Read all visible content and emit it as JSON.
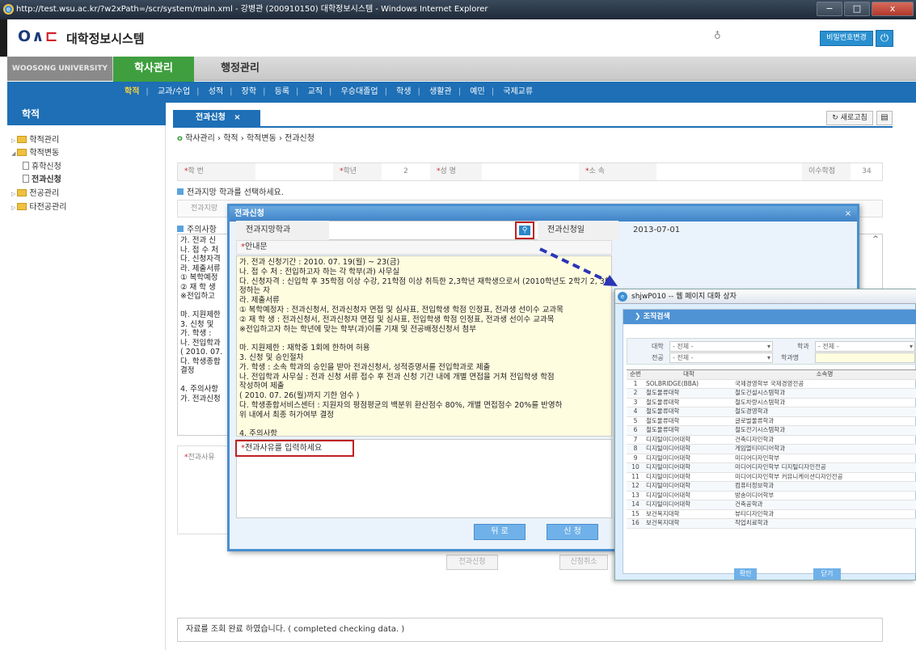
{
  "window": {
    "url": "http://test.wsu.ac.kr/?w2xPath=/scr/system/main.xml",
    "title_rest": " - 강병관 (200910150) 대학정보시스템 - Windows Internet Explorer",
    "btn_min": "−",
    "btn_max": "□",
    "btn_close": "x"
  },
  "header": {
    "logo_text": "대학정보시스템",
    "password_button": "비밀번호변경",
    "power_icon": "power-icon"
  },
  "mainmenu": {
    "university": "WOOSONG UNIVERSITY",
    "items": [
      "학사관리",
      "행정관리"
    ]
  },
  "submenu": {
    "items": [
      "학적",
      "교과/수업",
      "성적",
      "장학",
      "등록",
      "교직",
      "우승대졸업",
      "학생",
      "생활관",
      "예민",
      "국제교류"
    ]
  },
  "sidebar": {
    "title": "학적",
    "items": [
      "학적관리",
      "학적변동",
      "휴학신청",
      "전과신청",
      "전공관리",
      "타전공관리"
    ]
  },
  "content": {
    "tab_label": "전과신청",
    "tab_close": "×",
    "refresh": "새로고침",
    "breadcrumb": "학사관리 › 학적 › 학적변동 › 전과신청",
    "fields": {
      "hakbeon_label": "학 번",
      "haknyeon_label": "학년",
      "haknyeon_value": "2",
      "name_label": "성 명",
      "sosok_label": "소 속",
      "credits_label": "이수학점",
      "credits_value": "34"
    },
    "section_select": "전과지망 학과를 선택하세요.",
    "dept_label": "전과지망",
    "section_notes": "주의사항",
    "bg_notes": [
      "가. 전과 신",
      "나. 접 수 처",
      "다. 신청자격",
      "라. 제출서류",
      "① 복학예정",
      "② 재 학 생",
      "※전입하고",
      "",
      "마. 지원제한",
      "3. 신청 및",
      "가. 학생 :",
      "나. 전입학과",
      "( 2010. 07.",
      "다. 학생종합",
      "결정",
      "",
      "4. 주의사항",
      "가. 전과신청"
    ],
    "reason_label": "전과사유",
    "btn_apply": "전과신청",
    "btn_cancel": "신청취소",
    "status_message": "자료를 조회 완료 하였습니다. ( completed checking data. )"
  },
  "modal": {
    "title": "전과신청",
    "close": "×",
    "dept_label": "전과지망학과",
    "date_label": "전과신청일",
    "date_value": "2013-07-01",
    "guide_label": "안내문",
    "notice_lines": [
      "가. 전과 신청기간 : 2010. 07. 19(월) ~ 23(금)",
      "나. 접 수 처 : 전입하고자 하는 각 학부(과) 사무실",
      "다. 신청자격 : 신입학 후 35학점 이상 수강, 21학점 이상 취득한 2,3학년 재학생으로서 (2010학년도 2학기 2, 3학년 복학예정자 포함) 소속 학부(과)에서 인",
      "정하는 자",
      "라. 제출서류",
      "① 복학예정자 : 전과신청서, 전과신청자 면접 및 심사표, 전입학생 학점 인정표, 전과생 선이수 교과목",
      "② 재 학 생 : 전과신청서, 전과신청자 면접 및 심사표, 전입학생 학점 인정표, 전과생 선이수 교과목",
      "※전입하고자 하는 학년에 맞는 학부(과)이를 기재 및 전공배정신청서 첨부",
      "",
      "마. 지원제한 : 재학중 1회에 한하여 허용",
      "3. 신청 및 승인절차",
      "가. 학생 : 소속 학과의 승인을 받아 전과신청서, 성적증명서를 전입학과로 제출",
      "나. 전입학과 사무실 : 전과 신청 서류 접수 후 전과 신청 기간 내에 개별 면접을 거쳐 전입학생 학점",
      "작성하여 제출",
      "( 2010. 07. 26(월)까지 기한 엄수 )",
      "다. 학생종합서비스센터 : 지원자의 평점평균의 백분위 환산점수 80%, 개별 면접점수 20%를 반영하",
      "위 내에서 최종 허가여부 결정",
      "",
      "4. 주의사항"
    ],
    "reason_placeholder": "전과사유를 입력하세요",
    "btn_back": "뒤 로",
    "btn_apply": "신 청"
  },
  "popup": {
    "title": "shjwP010 -- 웹 페이지 대화 상자",
    "head": "조직검색",
    "filter": {
      "college_label": "대학",
      "college_value": "- 전체 -",
      "dept_label": "학과",
      "dept_value": "- 전체 -",
      "major_label": "전공",
      "major_value": "- 전체 -",
      "deptname_label": "학과명"
    },
    "columns": [
      "순번",
      "대학",
      "소속명"
    ],
    "rows": [
      [
        "1",
        "SOLBRIDGE(BBA)",
        "국제경영학부 국제경영전공"
      ],
      [
        "2",
        "철도물류대학",
        "철도건설시스템학과"
      ],
      [
        "3",
        "철도물류대학",
        "철도차량시스템학과"
      ],
      [
        "4",
        "철도물류대학",
        "철도경영학과"
      ],
      [
        "5",
        "철도물류대학",
        "글로벌물류학과"
      ],
      [
        "6",
        "철도물류대학",
        "철도전기시스템학과"
      ],
      [
        "7",
        "디지털미디어대학",
        "건축디자인학과"
      ],
      [
        "8",
        "디지털미디어대학",
        "게임멀티미디어학과"
      ],
      [
        "9",
        "디지털미디어대학",
        "미디어디자인학부"
      ],
      [
        "10",
        "디지털미디어대학",
        "미디어디자인학부 디지털디자인전공"
      ],
      [
        "11",
        "디지털미디어대학",
        "미디어디자인학부 커뮤니케이션디자인전공"
      ],
      [
        "12",
        "디지털미디어대학",
        "컴퓨터정보학과"
      ],
      [
        "13",
        "디지털미디어대학",
        "방송미디어학부"
      ],
      [
        "14",
        "디지털미디어대학",
        "건축공학과"
      ],
      [
        "15",
        "보건복지대학",
        "뷰티디자인학과"
      ],
      [
        "16",
        "보건복지대학",
        "작업치료학과"
      ]
    ],
    "btn_ok": "확인",
    "btn_close": "닫기"
  }
}
